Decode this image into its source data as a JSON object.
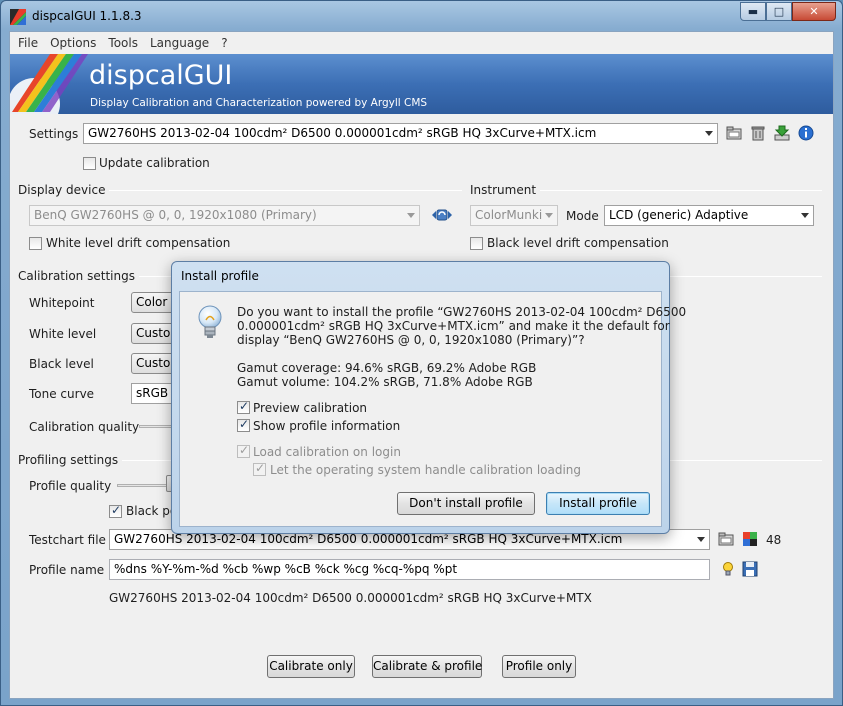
{
  "window": {
    "title": "dispcalGUI 1.1.8.3",
    "controls": {
      "minimize": "▬",
      "maximize": "□",
      "close": "✕"
    }
  },
  "menu": [
    "File",
    "Options",
    "Tools",
    "Language",
    "?"
  ],
  "banner": {
    "title": "dispcalGUI",
    "subtitle": "Display Calibration and Characterization powered by Argyll CMS"
  },
  "settings": {
    "label": "Settings",
    "value": "GW2760HS 2013-02-04 100cdm² D6500 0.000001cdm² sRGB HQ 3xCurve+MTX.icm",
    "update_calibration": {
      "label": "Update calibration",
      "checked": false
    }
  },
  "display_device": {
    "section": "Display device",
    "value": "BenQ GW2760HS @ 0, 0, 1920x1080 (Primary)",
    "white_drift": {
      "label": "White level drift compensation",
      "checked": false
    }
  },
  "instrument": {
    "section": "Instrument",
    "value": "ColorMunki",
    "mode_label": "Mode",
    "mode_value": "LCD (generic) Adaptive",
    "black_drift": {
      "label": "Black level drift compensation",
      "checked": false
    }
  },
  "calibration": {
    "section": "Calibration settings",
    "whitepoint": {
      "label": "Whitepoint",
      "value": "Color t"
    },
    "white_level": {
      "label": "White level",
      "value": "Custom"
    },
    "black_level": {
      "label": "Black level",
      "value": "Custom"
    },
    "tone_curve": {
      "label": "Tone curve",
      "value": "sRGB"
    },
    "quality": {
      "label": "Calibration quality"
    }
  },
  "profiling": {
    "section": "Profiling settings",
    "quality_label": "Profile quality",
    "black_point": {
      "label": "Black poi",
      "checked": true
    }
  },
  "testchart": {
    "label": "Testchart file",
    "value": "GW2760HS 2013-02-04 100cdm² D6500 0.000001cdm² sRGB HQ 3xCurve+MTX.icm",
    "count": "48"
  },
  "profile_name": {
    "label": "Profile name",
    "value": "%dns %Y-%m-%d %cb %wp %cB %ck %cg %cq-%pq %pt",
    "preview": "GW2760HS 2013-02-04 100cdm² D6500 0.000001cdm² sRGB HQ 3xCurve+MTX"
  },
  "actions": {
    "calibrate_only": "Calibrate only",
    "calibrate_profile": "Calibrate & profile",
    "profile_only": "Profile only"
  },
  "dialog": {
    "title": "Install profile",
    "message_lines": [
      "Do you want to install the profile “GW2760HS 2013-02-04 100cdm² D6500",
      "0.000001cdm² sRGB HQ 3xCurve+MTX.icm” and make it the default for",
      "display “BenQ GW2760HS @ 0, 0, 1920x1080 (Primary)”?"
    ],
    "gamut_coverage": "Gamut coverage: 94.6% sRGB, 69.2% Adobe RGB",
    "gamut_volume": "Gamut volume: 104.2% sRGB, 71.8% Adobe RGB",
    "preview_calibration": {
      "label": "Preview calibration",
      "checked": true
    },
    "show_profile_info": {
      "label": "Show profile information",
      "checked": true
    },
    "load_on_login": {
      "label": "Load calibration on login",
      "checked": true,
      "disabled": true
    },
    "os_handle": {
      "label": "Let the operating system handle calibration loading",
      "checked": true,
      "disabled": true
    },
    "dont_install": "Don't install profile",
    "install": "Install profile"
  },
  "colors": {
    "banner": "#3c6fb5",
    "default_button_border": "#3c7fb1",
    "window_frame": "#86acd0"
  }
}
